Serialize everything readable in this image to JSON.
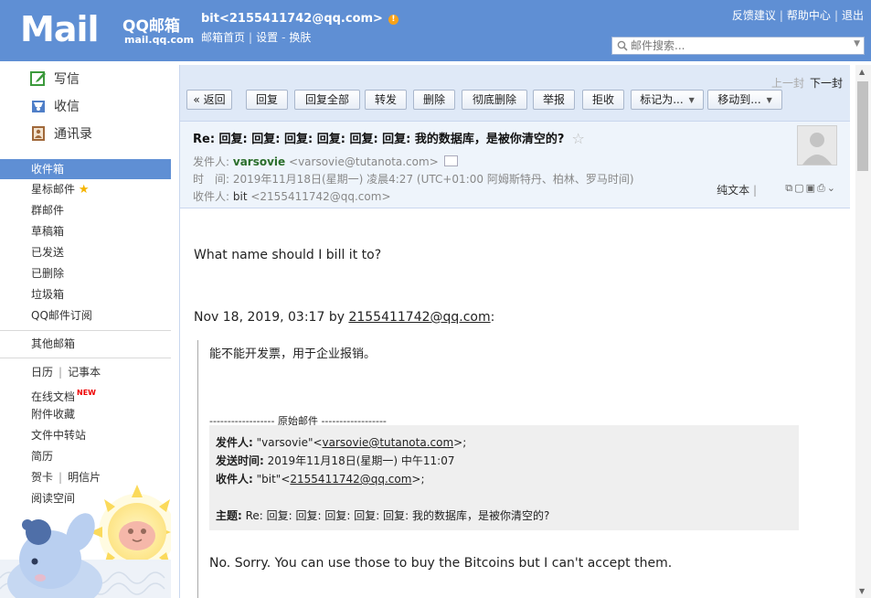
{
  "header": {
    "logo_text": "Mail",
    "brand_name": "QQ邮箱",
    "brand_url": "mail.qq.com",
    "user_account": "bit<2155411742@qq.com>",
    "nav": [
      "邮箱首页",
      "设置",
      "换肤"
    ],
    "toplinks": [
      "反馈建议",
      "帮助中心",
      "退出"
    ],
    "search_placeholder": "邮件搜索..."
  },
  "sidebar": {
    "compose": "写信",
    "receive": "收信",
    "contacts": "通讯录",
    "inbox": "收件箱",
    "starred": "星标邮件",
    "group": "群邮件",
    "drafts": "草稿箱",
    "sent": "已发送",
    "deleted": "已删除",
    "spam": "垃圾箱",
    "subscriptions": "QQ邮件订阅",
    "other_mailbox": "其他邮箱",
    "calendar": "日历",
    "notes": "记事本",
    "online_docs": "在线文档",
    "new_tag": "NEW",
    "attachments": "附件收藏",
    "file_transfer": "文件中转站",
    "resume": "简历",
    "greeting_card": "贺卡",
    "postcard": "明信片",
    "reading_space": "阅读空间"
  },
  "toolbar": {
    "prev": "上一封",
    "next": "下一封",
    "back": "« 返回",
    "reply": "回复",
    "reply_all": "回复全部",
    "forward": "转发",
    "delete": "删除",
    "delete_permanent": "彻底删除",
    "report": "举报",
    "reject": "拒收",
    "mark_as": "标记为...",
    "move_to": "移动到..."
  },
  "mail": {
    "subject": "Re: 回复:  回复:  回复:  回复:  回复:  回复:  我的数据库，是被你清空的?",
    "from_label": "发件人:",
    "from_name": "varsovie",
    "from_addr": "<varsovie@tutanota.com>",
    "time_label": "时　间:",
    "time_value": "2019年11月18日(星期一) 凌晨4:27 (UTC+01:00 阿姆斯特丹、柏林、罗马时间)",
    "to_label": "收件人:",
    "to_name": "bit",
    "to_addr": "<2155411742@qq.com>",
    "plain_text": "纯文本",
    "body_line1": "What name should I bill it to?",
    "quote_header_prefix": "Nov 18, 2019, 03:17 by ",
    "quote_header_link": "2155411742@qq.com",
    "quote_header_suffix": ":",
    "quote_line1": "能不能开发票，用于企业报销。",
    "orig_divider": "------------------ 原始邮件 ------------------",
    "orig_from_label": "发件人:",
    "orig_from_value_pre": " \"varsovie\"<",
    "orig_from_link": "varsovie@tutanota.com",
    "orig_from_value_post": ">;",
    "orig_time_label": "发送时间:",
    "orig_time_value": " 2019年11月18日(星期一) 中午11:07",
    "orig_to_label": "收件人:",
    "orig_to_value_pre": " \"bit\"<",
    "orig_to_link": "2155411742@qq.com",
    "orig_to_value_post": ">;",
    "orig_subject_label": "主题:",
    "orig_subject_value": " Re: 回复:  回复:  回复:  回复:  回复:  我的数据库，是被你清空的?",
    "reply_line": "No. Sorry. You can use those to buy the Bitcoins but I can't accept them."
  },
  "colors": {
    "header_bg": "#5f8fd4",
    "toolbar_bg": "#dfe9f7",
    "mailhead_bg": "#eef4fb",
    "selected_folder": "#5f8fd4"
  }
}
